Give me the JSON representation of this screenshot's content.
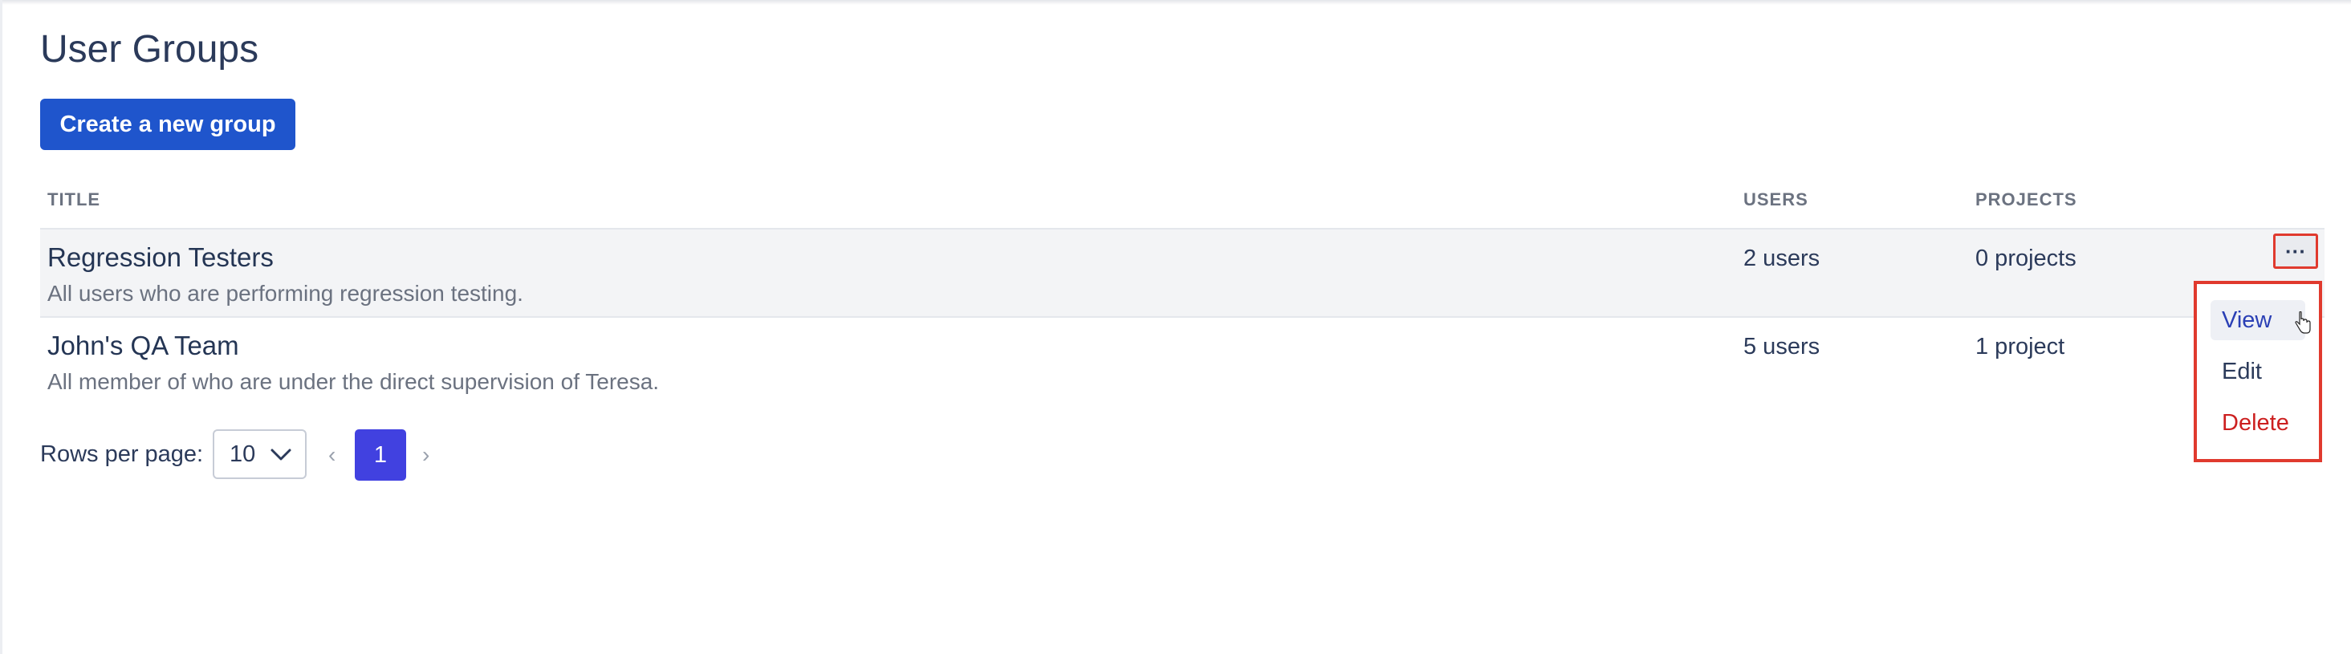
{
  "page": {
    "title": "User Groups",
    "create_button_label": "Create a new group"
  },
  "table": {
    "headers": {
      "title": "TITLE",
      "users": "USERS",
      "projects": "PROJECTS"
    },
    "rows": [
      {
        "title": "Regression Testers",
        "description": "All users who are performing regression testing.",
        "users": "2 users",
        "projects": "0 projects"
      },
      {
        "title": "John's QA Team",
        "description": "All member of who are under the direct supervision of Teresa.",
        "users": "5 users",
        "projects": "1 project"
      }
    ],
    "actions_button_label": "···",
    "actions_menu": {
      "view": "View",
      "edit": "Edit",
      "delete": "Delete"
    }
  },
  "pagination": {
    "rows_per_page_label": "Rows per page:",
    "rows_per_page_value": "10",
    "prev_symbol": "‹",
    "next_symbol": "›",
    "current_page": "1"
  },
  "colors": {
    "primary_button": "#1f55cc",
    "active_page": "#4141e0",
    "delete_text": "#cc1f1f",
    "highlight_border": "#e03a2e"
  }
}
